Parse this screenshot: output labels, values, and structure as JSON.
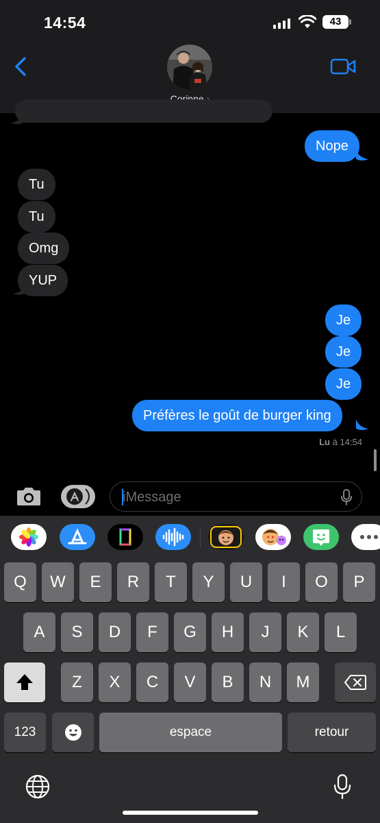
{
  "status_bar": {
    "time": "14:54",
    "battery": "43"
  },
  "header": {
    "contact_name": "Corinne",
    "contact_chevron": "›"
  },
  "messages": [
    {
      "side": "sent",
      "text": "Nope"
    },
    {
      "side": "received",
      "text": "Tu"
    },
    {
      "side": "received",
      "text": "Tu"
    },
    {
      "side": "received",
      "text": "Omg"
    },
    {
      "side": "received",
      "text": "YUP"
    },
    {
      "side": "sent",
      "text": "Je"
    },
    {
      "side": "sent",
      "text": "Je"
    },
    {
      "side": "sent",
      "text": "Je"
    },
    {
      "side": "sent",
      "text": "Préfères le goût de burger king"
    }
  ],
  "read_receipt": {
    "label": "Lu",
    "connector": "à",
    "time": "14:54"
  },
  "input": {
    "placeholder": "iMessage"
  },
  "apps": [
    "photos-icon",
    "app-store-icon",
    "gif-app-icon",
    "audio-message-icon",
    "memoji-icon",
    "animoji-icon",
    "green-app-icon",
    "more-apps-icon"
  ],
  "keyboard": {
    "row1": [
      "Q",
      "W",
      "E",
      "R",
      "T",
      "Y",
      "U",
      "I",
      "O",
      "P"
    ],
    "row2": [
      "A",
      "S",
      "D",
      "F",
      "G",
      "H",
      "J",
      "K",
      "L"
    ],
    "row3": [
      "Z",
      "X",
      "C",
      "V",
      "B",
      "N",
      "M"
    ],
    "numbers": "123",
    "space": "espace",
    "return": "retour"
  },
  "colors": {
    "sent": "#1e81f5",
    "received": "#262628",
    "accent": "#1e81f5"
  }
}
